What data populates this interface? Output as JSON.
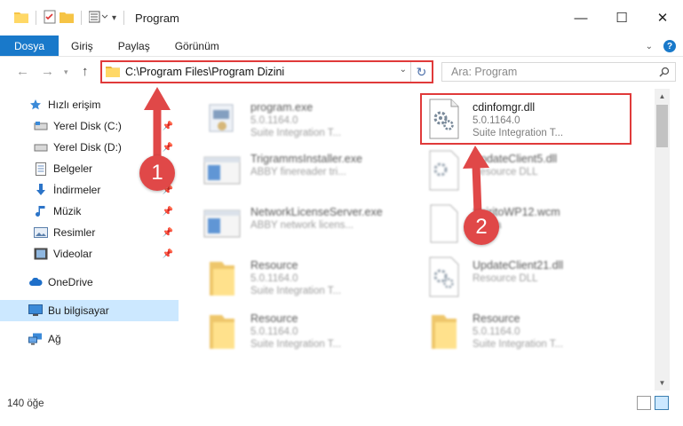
{
  "window": {
    "title": "Program",
    "controls": {
      "minimize": "—",
      "maximize": "☐",
      "close": "✕"
    }
  },
  "ribbon": {
    "tabs": [
      "Dosya",
      "Giriş",
      "Paylaş",
      "Görünüm"
    ],
    "help": "?"
  },
  "navigation": {
    "address_path": "C:\\Program Files\\Program Dizini",
    "search_placeholder": "Ara: Program"
  },
  "sidebar": {
    "items": [
      {
        "label": "Hızlı erişim",
        "icon": "star-icon",
        "pinned": false
      },
      {
        "label": "Yerel Disk (C:)",
        "icon": "drive-icon",
        "pinned": true
      },
      {
        "label": "Yerel Disk (D:)",
        "icon": "drive-icon",
        "pinned": true
      },
      {
        "label": "Belgeler",
        "icon": "document-icon",
        "pinned": true
      },
      {
        "label": "İndirmeler",
        "icon": "download-icon",
        "pinned": true
      },
      {
        "label": "Müzik",
        "icon": "music-icon",
        "pinned": true
      },
      {
        "label": "Resimler",
        "icon": "pictures-icon",
        "pinned": true
      },
      {
        "label": "Videolar",
        "icon": "video-icon",
        "pinned": true
      },
      {
        "label": "OneDrive",
        "icon": "cloud-icon",
        "pinned": false
      },
      {
        "label": "Bu bilgisayar",
        "icon": "computer-icon",
        "pinned": false,
        "selected": true
      },
      {
        "label": "Ağ",
        "icon": "network-icon",
        "pinned": false
      }
    ]
  },
  "files": [
    {
      "name": "program.exe",
      "line1": "5.0.1164.0",
      "line2": "Suite Integration T...",
      "icon": "exe-icon",
      "blurred": true
    },
    {
      "name": "cdinfomgr.dll",
      "line1": "5.0.1164.0",
      "line2": "Suite Integration T...",
      "icon": "dll-gear-icon",
      "blurred": false
    },
    {
      "name": "TrigrammsInstaller.exe",
      "line1": "ABBY finereader tri...",
      "line2": "",
      "icon": "exe-window-icon",
      "blurred": true
    },
    {
      "name": "UpdateClient5.dll",
      "line1": "Resource DLL",
      "line2": "",
      "icon": "dll-gear-icon",
      "blurred": true
    },
    {
      "name": "NetworkLicenseServer.exe",
      "line1": "ABBY network licens...",
      "line2": "",
      "icon": "exe-window-icon",
      "blurred": true
    },
    {
      "name": "SpiritoWP12.wcm",
      "line1": "Dosya",
      "line2": "",
      "icon": "file-blank-icon",
      "blurred": true
    },
    {
      "name": "Resource",
      "line1": "5.0.1164.0",
      "line2": "Suite Integration T...",
      "icon": "folder-icon",
      "blurred": true
    },
    {
      "name": "UpdateClient21.dll",
      "line1": "Resource DLL",
      "line2": "",
      "icon": "dll-gear-icon",
      "blurred": true
    },
    {
      "name": "Resource",
      "line1": "5.0.1164.0",
      "line2": "Suite Integration T...",
      "icon": "folder-icon",
      "blurred": true
    },
    {
      "name": "Resource",
      "line1": "5.0.1164.0",
      "line2": "Suite Integration T...",
      "icon": "folder-icon",
      "blurred": true
    }
  ],
  "status": {
    "count": "140 öğe"
  },
  "annotations": {
    "step1": "1",
    "step2": "2",
    "color": "#e04848"
  }
}
